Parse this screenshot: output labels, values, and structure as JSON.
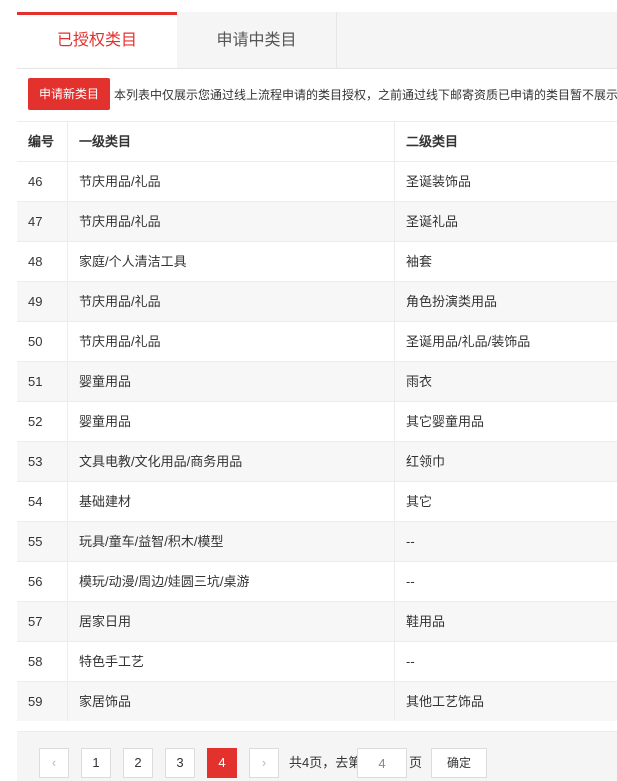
{
  "tabs": {
    "authorized": "已授权类目",
    "applying": "申请中类目"
  },
  "toolbar": {
    "apply_label": "申请新类目",
    "notice": "本列表中仅展示您通过线上流程申请的类目授权，之前通过线下邮寄资质已申请的类目暂不展示"
  },
  "table": {
    "headers": [
      "编号",
      "一级类目",
      "二级类目"
    ],
    "rows": [
      [
        "46",
        "节庆用品/礼品",
        "圣诞装饰品"
      ],
      [
        "47",
        "节庆用品/礼品",
        "圣诞礼品"
      ],
      [
        "48",
        "家庭/个人清洁工具",
        "袖套"
      ],
      [
        "49",
        "节庆用品/礼品",
        "角色扮演类用品"
      ],
      [
        "50",
        "节庆用品/礼品",
        "圣诞用品/礼品/装饰品"
      ],
      [
        "51",
        "婴童用品",
        "雨衣"
      ],
      [
        "52",
        "婴童用品",
        "其它婴童用品"
      ],
      [
        "53",
        "文具电教/文化用品/商务用品",
        "红领巾"
      ],
      [
        "54",
        "基础建材",
        "其它"
      ],
      [
        "55",
        "玩具/童车/益智/积木/模型",
        "--"
      ],
      [
        "56",
        "模玩/动漫/周边/娃圆三坑/桌游",
        "--"
      ],
      [
        "57",
        "居家日用",
        "鞋用品"
      ],
      [
        "58",
        "特色手工艺",
        "--"
      ],
      [
        "59",
        "家居饰品",
        "其他工艺饰品"
      ]
    ]
  },
  "pagination": {
    "prev_icon": "‹",
    "next_icon": "›",
    "pages": [
      "1",
      "2",
      "3",
      "4"
    ],
    "current": "4",
    "total_text": "共4页，去第",
    "goto_value": "4",
    "page_suffix": "页",
    "confirm_label": "确定"
  }
}
